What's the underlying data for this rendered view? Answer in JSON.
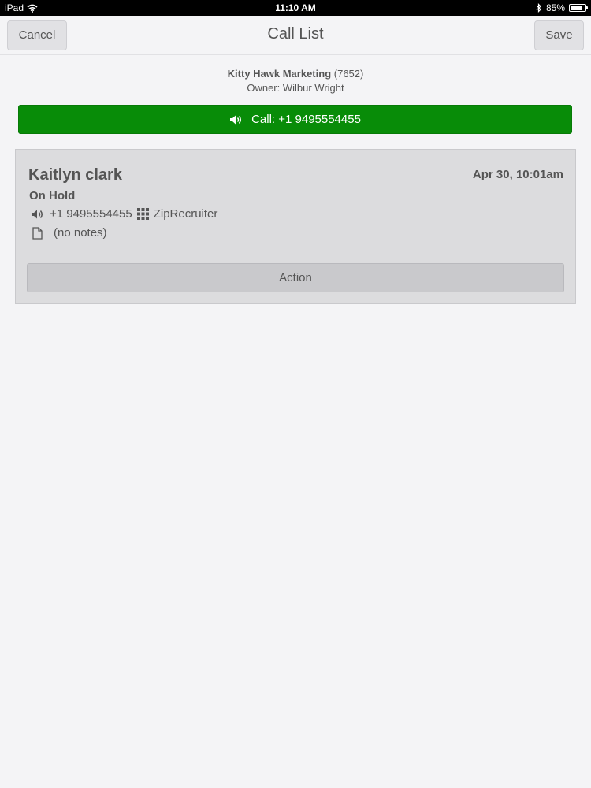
{
  "status_bar": {
    "device": "iPad",
    "time": "11:10 AM",
    "battery_percent": "85%",
    "battery_level": 0.85,
    "icons": [
      "wifi-icon",
      "bluetooth-icon",
      "battery-icon"
    ]
  },
  "navbar": {
    "title": "Call List",
    "cancel_label": "Cancel",
    "save_label": "Save"
  },
  "header": {
    "company_name": "Kitty Hawk Marketing",
    "company_id": "(7652)",
    "owner": "Owner: Wilbur Wright"
  },
  "call_button": {
    "label": "Call: +1 9495554455",
    "icon": "speaker-icon",
    "color": "#088c08"
  },
  "contact": {
    "name": "Kaitlyn clark",
    "date": "Apr 30, 10:01am",
    "status": "On Hold",
    "phone": "+1 9495554455",
    "source": "ZipRecruiter",
    "notes": "(no notes)",
    "action_label": "Action",
    "icons": [
      "speaker-icon",
      "grid-icon",
      "document-icon"
    ]
  }
}
